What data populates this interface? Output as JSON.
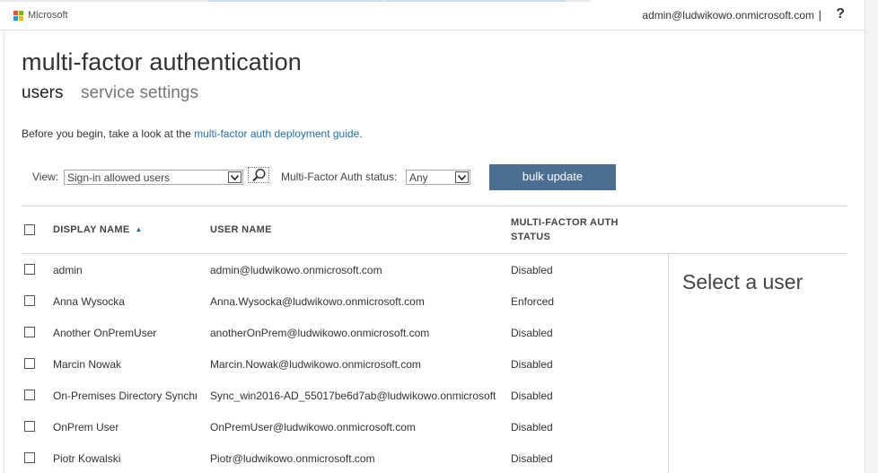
{
  "header": {
    "brand": "Microsoft",
    "user_email": "admin@ludwikowo.onmicrosoft.com",
    "separator": "|",
    "help": "?"
  },
  "page_title": "multi-factor authentication",
  "tabs": [
    {
      "label": "users",
      "active": true
    },
    {
      "label": "service settings",
      "active": false
    }
  ],
  "intro": {
    "text": "Before you begin, take a look at the ",
    "link": "multi-factor auth deployment guide",
    "suffix": "."
  },
  "filters": {
    "view_label": "View:",
    "view_value": "Sign-in allowed users",
    "mfa_status_label": "Multi-Factor Auth status:",
    "mfa_status_value": "Any",
    "bulk_update_label": "bulk update"
  },
  "table": {
    "columns": {
      "display_name": "DISPLAY NAME",
      "user_name": "USER NAME",
      "mfa_status_line1": "MULTI-FACTOR AUTH",
      "mfa_status_line2": "STATUS"
    },
    "sort": "display_name ascending",
    "rows": [
      {
        "display_name": "admin",
        "user_name": "admin@ludwikowo.onmicrosoft.com",
        "status": "Disabled"
      },
      {
        "display_name": "Anna Wysocka",
        "user_name": "Anna.Wysocka@ludwikowo.onmicrosoft.com",
        "status": "Enforced"
      },
      {
        "display_name": "Another OnPremUser",
        "user_name": "anotherOnPrem@ludwikowo.onmicrosoft.com",
        "status": "Disabled"
      },
      {
        "display_name": "Marcin Nowak",
        "user_name": "Marcin.Nowak@ludwikowo.onmicrosoft.com",
        "status": "Disabled"
      },
      {
        "display_name": "On-Premises Directory Synchr",
        "user_name": "Sync_win2016-AD_55017be6d7ab@ludwikowo.onmicrosoft",
        "status": "Disabled"
      },
      {
        "display_name": "OnPrem User",
        "user_name": "OnPremUser@ludwikowo.onmicrosoft.com",
        "status": "Disabled"
      },
      {
        "display_name": "Piotr Kowalski",
        "user_name": "Piotr@ludwikowo.onmicrosoft.com",
        "status": "Disabled"
      }
    ]
  },
  "detail_panel": {
    "placeholder": "Select a user"
  },
  "colors": {
    "accent_button": "#4a6f93",
    "link": "#1f6fa8",
    "logo": [
      "#f25022",
      "#7fba00",
      "#00a4ef",
      "#ffb900"
    ]
  },
  "icons": {
    "search": "search-icon",
    "dropdown": "chevron-down-icon",
    "sort": "sort-ascending-icon"
  }
}
